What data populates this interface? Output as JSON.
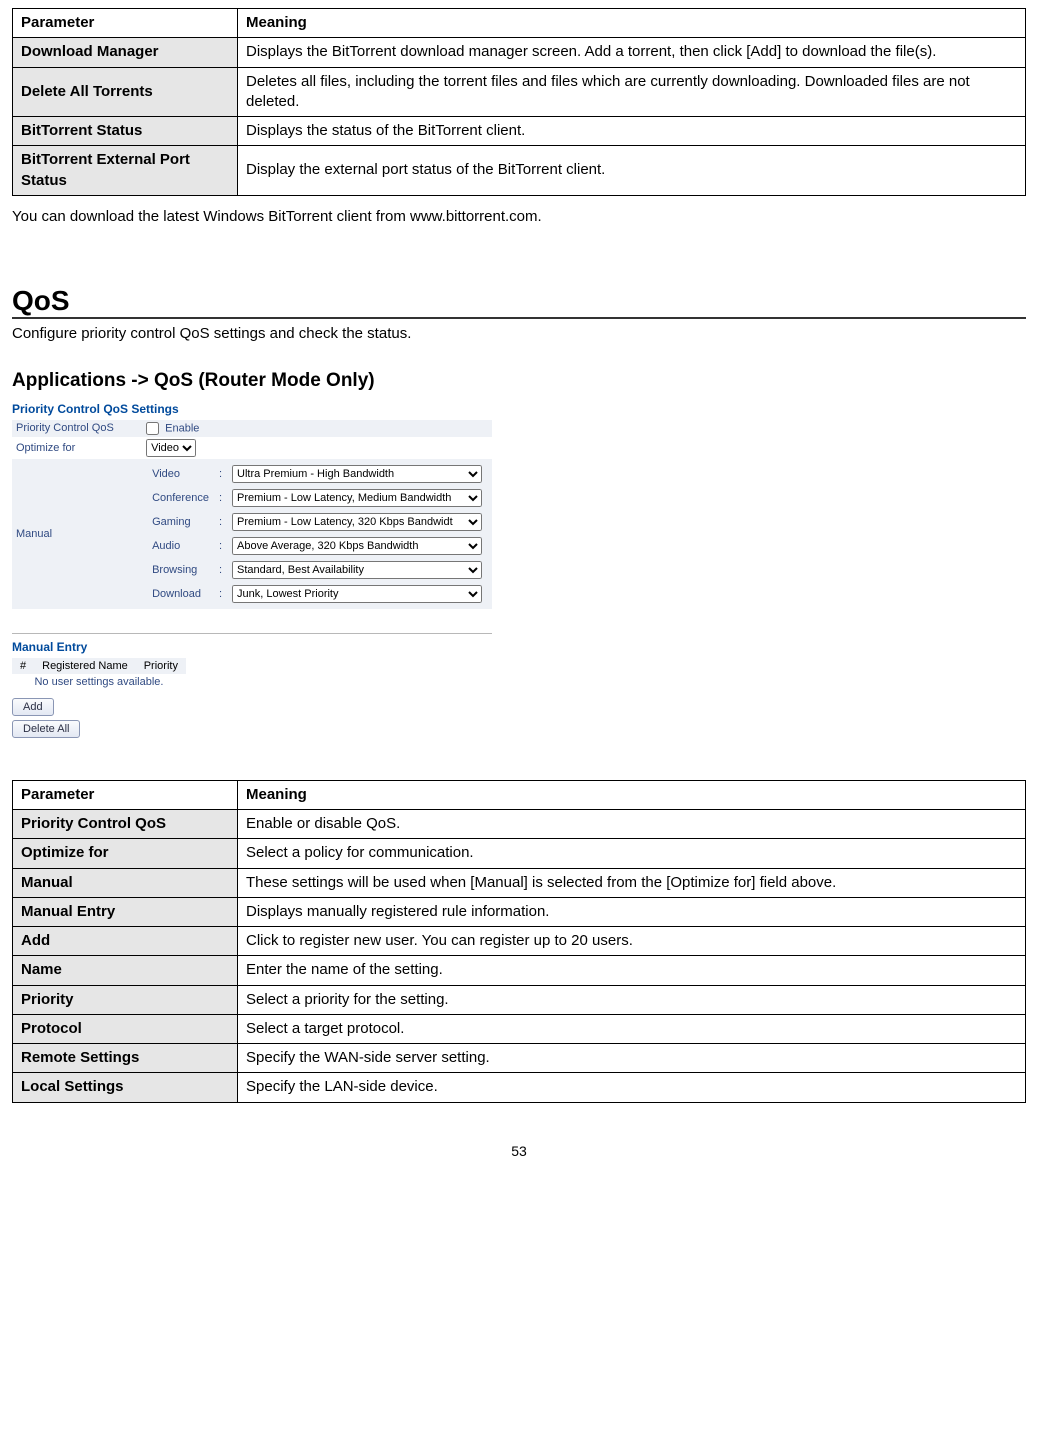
{
  "table1": {
    "headParam": "Parameter",
    "headMeaning": "Meaning",
    "rows": [
      {
        "p": "Download Manager",
        "m": "Displays the BitTorrent download manager screen.  Add a torrent, then click [Add] to download the file(s)."
      },
      {
        "p": "Delete All Torrents",
        "m": "Deletes all files, including the torrent files and files which are currently downloading. Downloaded files are not deleted."
      },
      {
        "p": "BitTorrent Status",
        "m": "Displays the status of the BitTorrent client."
      },
      {
        "p": "BitTorrent External Port Status",
        "m": "Display the external port status of the BitTorrent client."
      }
    ]
  },
  "afterTable1": "You can download the latest Windows BitTorrent client from www.bittorrent.com.",
  "qos": {
    "title": "QoS",
    "intro": "Configure priority control QoS settings and check the status.",
    "subtitle": "Applications -> QoS (Router Mode Only)"
  },
  "mock": {
    "heading1": "Priority Control QoS Settings",
    "rowPriorityLabel": "Priority Control QoS",
    "enableLabel": "Enable",
    "rowOptimizeLabel": "Optimize for",
    "optimizeValue": "Video",
    "rowManualLabel": "Manual",
    "manual": {
      "video": {
        "label": "Video",
        "value": "Ultra Premium - High Bandwidth"
      },
      "conference": {
        "label": "Conference",
        "value": "Premium - Low Latency, Medium Bandwidth"
      },
      "gaming": {
        "label": "Gaming",
        "value": "Premium - Low Latency, 320 Kbps Bandwidt"
      },
      "audio": {
        "label": "Audio",
        "value": "Above Average, 320 Kbps Bandwidth"
      },
      "browsing": {
        "label": "Browsing",
        "value": "Standard, Best Availability"
      },
      "download": {
        "label": "Download",
        "value": "Junk, Lowest Priority"
      }
    },
    "heading2": "Manual Entry",
    "entryCols": {
      "c1": "#",
      "c2": "Registered Name",
      "c3": "Priority"
    },
    "noUser": "No user settings available.",
    "addBtn": "Add",
    "deleteAllBtn": "Delete All"
  },
  "table2": {
    "headParam": "Parameter",
    "headMeaning": "Meaning",
    "rows": [
      {
        "p": "Priority Control QoS",
        "m": "Enable or disable QoS."
      },
      {
        "p": "Optimize for",
        "m": "Select a policy for communication."
      },
      {
        "p": "Manual",
        "m": "These settings will be used when [Manual] is selected from the [Optimize for] field above."
      },
      {
        "p": "Manual Entry",
        "m": "Displays manually registered rule information."
      },
      {
        "p": "Add",
        "m": "Click to register new user. You can register up to 20 users."
      },
      {
        "p": "Name",
        "m": "Enter the name of the setting."
      },
      {
        "p": "Priority",
        "m": "Select a priority for the setting."
      },
      {
        "p": "Protocol",
        "m": "Select a target protocol."
      },
      {
        "p": "Remote Settings",
        "m": "Specify the WAN-side server setting."
      },
      {
        "p": "Local Settings",
        "m": "Specify the LAN-side device."
      }
    ]
  },
  "pageNumber": "53"
}
